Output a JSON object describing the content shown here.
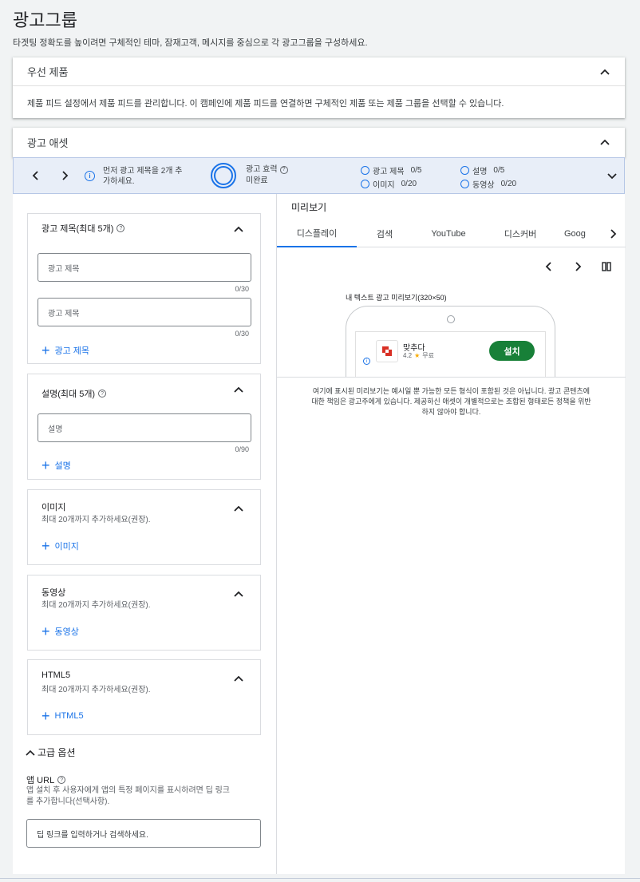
{
  "page": {
    "title": "광고그룹",
    "subtitle": "타겟팅 정확도를 높이려면 구체적인 테마, 잠재고객, 메시지를 중심으로 각 광고그룹을 구성하세요."
  },
  "product_card": {
    "title": "우선 제품",
    "body": "제품 피드 설정에서 제품 피드를 관리합니다. 이 캠페인에 제품 피드를 연결하면 구체적인 제품 또는 제품 그룹을 선택할 수 있습니다."
  },
  "assets_card": {
    "title": "광고 애셋"
  },
  "strength_strip": {
    "info_line1": "먼저 광고 제목을 2개 추",
    "info_line2": "가하세요.",
    "strength_label": "광고 효력",
    "strength_value": "미완료",
    "requirements": [
      {
        "label": "광고 제목",
        "count": "0/5"
      },
      {
        "label": "설명",
        "count": "0/5"
      },
      {
        "label": "이미지",
        "count": "0/20"
      },
      {
        "label": "동영상",
        "count": "0/20"
      }
    ]
  },
  "headlines": {
    "title": "광고 제목(최대 5개)",
    "inputs": [
      {
        "placeholder": "광고 제목",
        "counter": "0/30"
      },
      {
        "placeholder": "광고 제목",
        "counter": "0/30"
      }
    ],
    "add_label": "광고 제목"
  },
  "descriptions": {
    "title": "설명(최대 5개)",
    "input": {
      "placeholder": "설명",
      "counter": "0/90"
    },
    "add_label": "설명"
  },
  "images": {
    "title": "이미지",
    "desc": "최대 20개까지 추가하세요(권장).",
    "add_label": "이미지"
  },
  "videos": {
    "title": "동영상",
    "desc": "최대 20개까지 추가하세요(권장).",
    "add_label": "동영상"
  },
  "html5": {
    "title": "HTML5",
    "desc": "최대 20개까지 추가하세요(권장).",
    "add_label": "HTML5"
  },
  "advanced": {
    "toggle_label": "고급 옵션",
    "app_url_label": "앱 URL",
    "app_url_desc_line1": "앱 설치 후 사용자에게 앱의 특정 페이지를 표시하려면 딥 링크",
    "app_url_desc_line2": "를 추가합니다(선택사항).",
    "app_url_placeholder": "딥 링크를 입력하거나 검색하세요."
  },
  "preview": {
    "title": "미리보기",
    "tabs": [
      "디스플레이",
      "검색",
      "YouTube",
      "디스커버",
      "Goog"
    ],
    "ad_caption": "내 텍스트 광고 미리보기(320×50)",
    "app_name": "맞추다",
    "rating": "4.2",
    "price": "무료",
    "install_label": "설치",
    "disclaimer_line1": "여기에 표시된 미리보기는 예시일 뿐 가능한 모든 형식이 포함된 것은 아닙니다. 광고 콘텐츠에",
    "disclaimer_line2": "대한 책임은 광고주에게 있습니다. 제공하신 애셋이 개별적으로는 조합된 형태로든 정책을 위반",
    "disclaimer_line3": "하지 않아야 합니다."
  },
  "colors": {
    "accent": "#1a73e8",
    "install_button": "#188038",
    "strip_bg": "#e8eef8"
  }
}
